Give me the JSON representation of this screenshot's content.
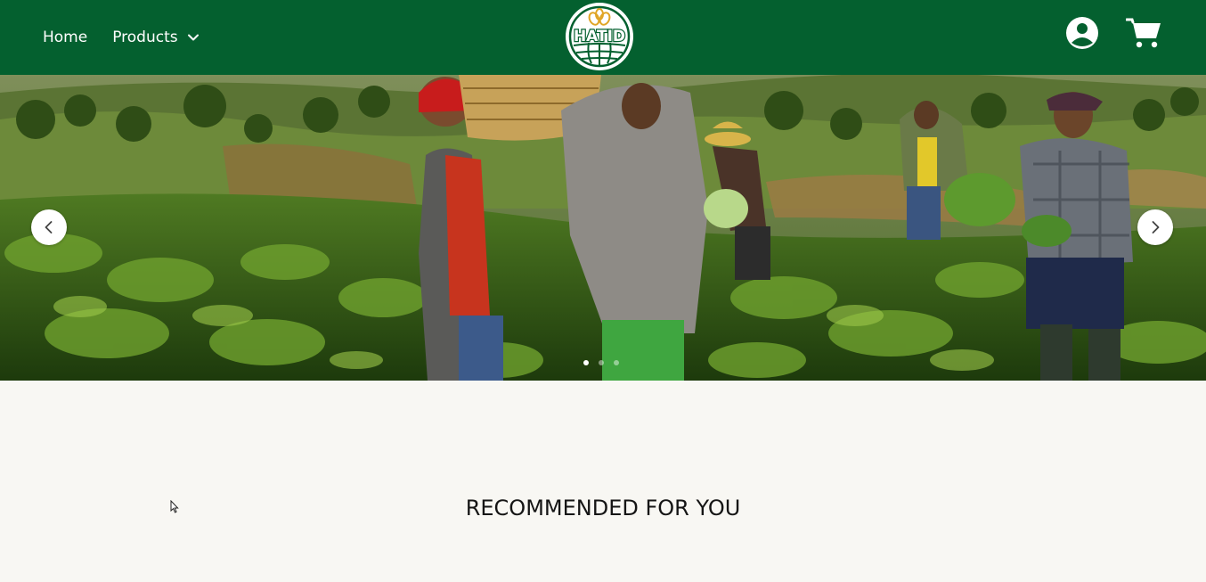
{
  "nav": {
    "home_label": "Home",
    "products_label": "Products",
    "logo_text": "HATID"
  },
  "hero": {
    "active_slide": 1,
    "total_slides": 3
  },
  "main": {
    "section_title": "RECOMMENDED FOR YOU"
  },
  "colors": {
    "brand_green": "#04602f",
    "page_background": "#f8f7f3"
  }
}
